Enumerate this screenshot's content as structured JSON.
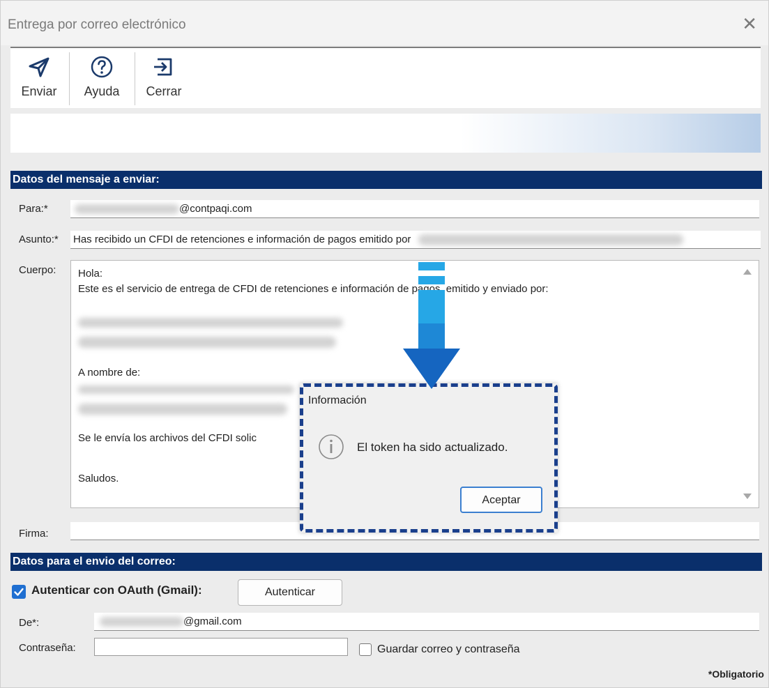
{
  "window": {
    "title": "Entrega por correo electrónico",
    "close_glyph": "✕"
  },
  "toolbar": {
    "send_label": "Enviar",
    "help_label": "Ayuda",
    "close_label": "Cerrar"
  },
  "message_section": {
    "header": "Datos del mensaje a enviar:",
    "to_label": "Para:*",
    "to_value_visible": "@contpaqi.com",
    "subject_label": "Asunto:*",
    "subject_value": "Has recibido un CFDI de retenciones e información de pagos emitido por",
    "body_label": "Cuerpo:",
    "body_lines": {
      "greeting": "Hola:",
      "intro": "Este es el servicio de entrega de CFDI de retenciones e información de pagos, emitido y enviado por:",
      "on_behalf": "A nombre de:",
      "files": "Se le envía los archivos del CFDI solic",
      "closing": "Saludos."
    },
    "signature_label": "Firma:"
  },
  "send_section": {
    "header": "Datos para el envio del correo:",
    "oauth_label": "Autenticar con OAuth (Gmail):",
    "oauth_checked": true,
    "authenticate_button": "Autenticar",
    "from_label": "De*:",
    "from_value_visible": "@gmail.com",
    "password_label": "Contraseña:",
    "save_label": "Guardar correo y contraseña",
    "save_checked": false,
    "required_note": "*Obligatorio"
  },
  "info_dialog": {
    "title": "Información",
    "message": "El token ha sido actualizado.",
    "ok_button": "Aceptar"
  },
  "colors": {
    "section_header": "#0a2f6b",
    "checkbox": "#1f6fd1",
    "arrow_light": "#26a7e6",
    "arrow_dark": "#1565c0",
    "dialog_highlight": "#1a3f8c"
  },
  "icons": {
    "send": "paper-plane-icon",
    "help": "question-circle-icon",
    "close": "exit-arrow-icon",
    "info": "info-circle-icon"
  }
}
